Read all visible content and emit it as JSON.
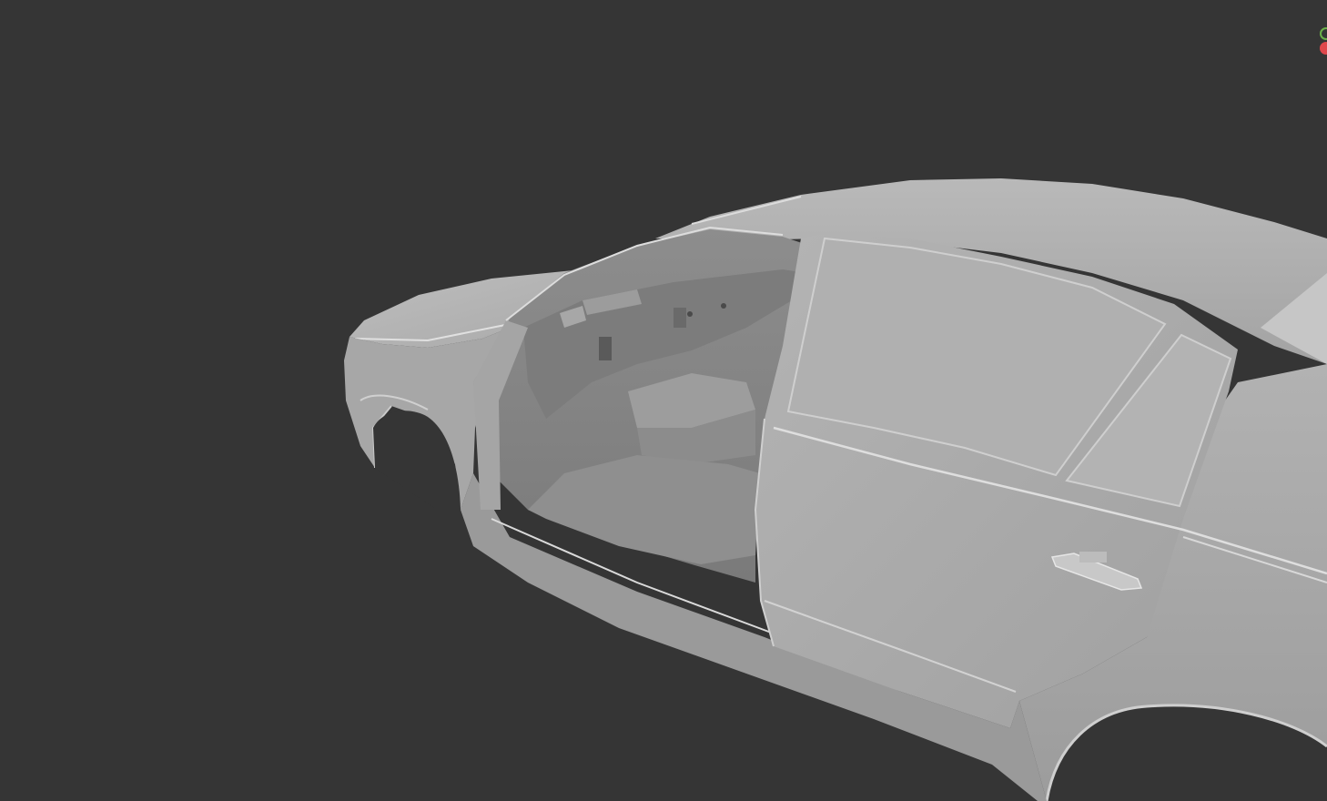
{
  "viewport": {
    "background_color": "#353535",
    "model_base_color": "#a9a9a9",
    "model_highlight_color": "#c4c4c4",
    "model_shadow_color": "#6e6e6e",
    "edge_color": "#e2e2e2"
  },
  "gizmo": {
    "y_axis_color": "#6cb04a",
    "x_axis_color": "#e0474c"
  }
}
